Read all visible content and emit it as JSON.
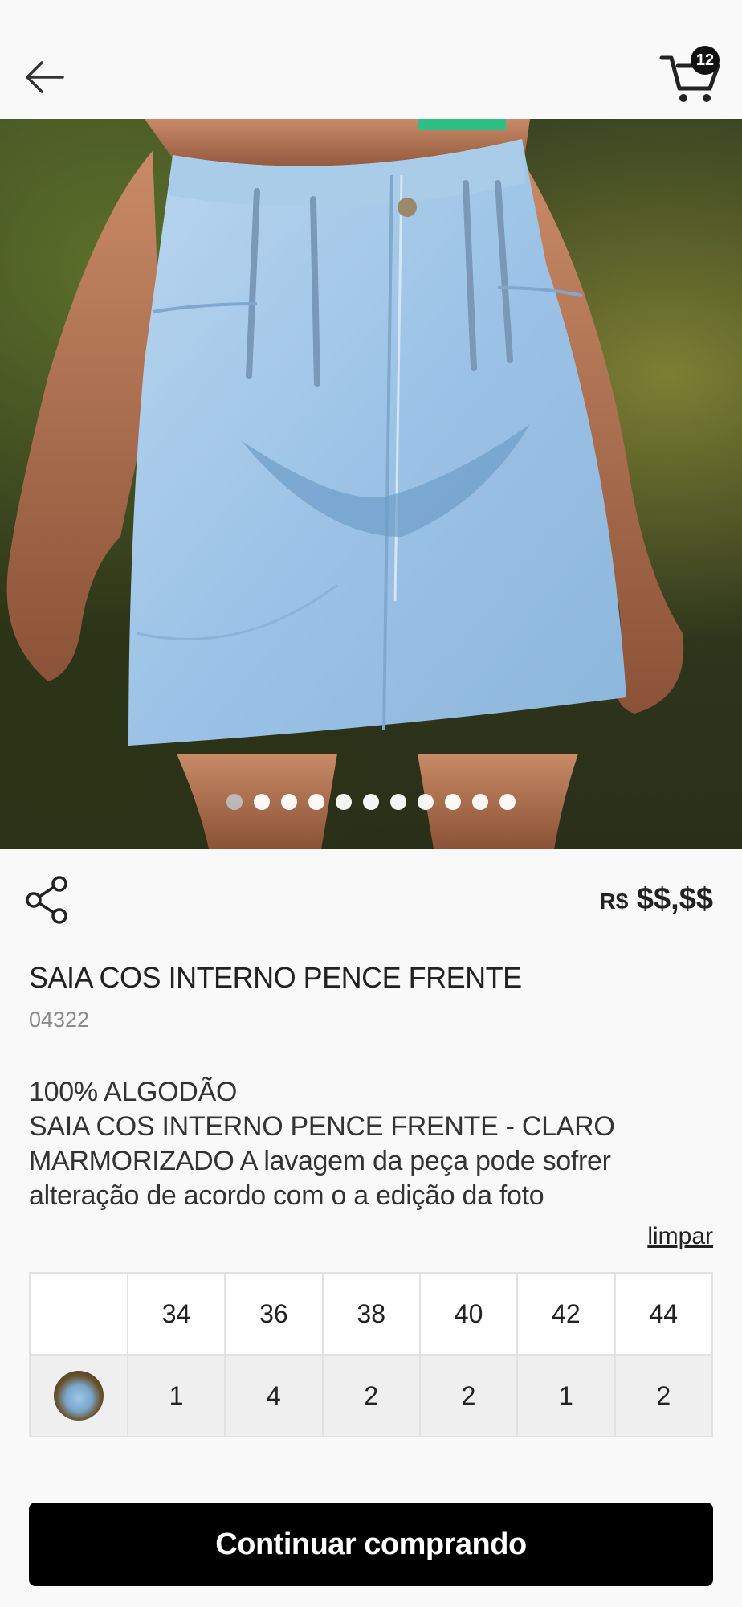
{
  "header": {
    "cart_count": "12"
  },
  "gallery": {
    "total_images": 11,
    "active_index": 0
  },
  "product": {
    "price_currency": "R$",
    "price_value": "$$,$$",
    "title": "SAIA COS INTERNO PENCE FRENTE",
    "code": "04322",
    "description_line1": "100% ALGODÃO",
    "description_line2": "SAIA COS INTERNO PENCE FRENTE - CLARO MARMORIZADO A lavagem da peça pode sofrer alteração de acordo com o a edição da foto"
  },
  "size_grid": {
    "clear_label": "limpar",
    "sizes": [
      "34",
      "36",
      "38",
      "40",
      "42",
      "44"
    ],
    "quantities": [
      "1",
      "4",
      "2",
      "2",
      "1",
      "2"
    ]
  },
  "footer": {
    "continue_label": "Continuar comprando"
  },
  "colors": {
    "button_bg": "#000000",
    "badge_bg": "#111111",
    "background": "#f9f9f9"
  }
}
